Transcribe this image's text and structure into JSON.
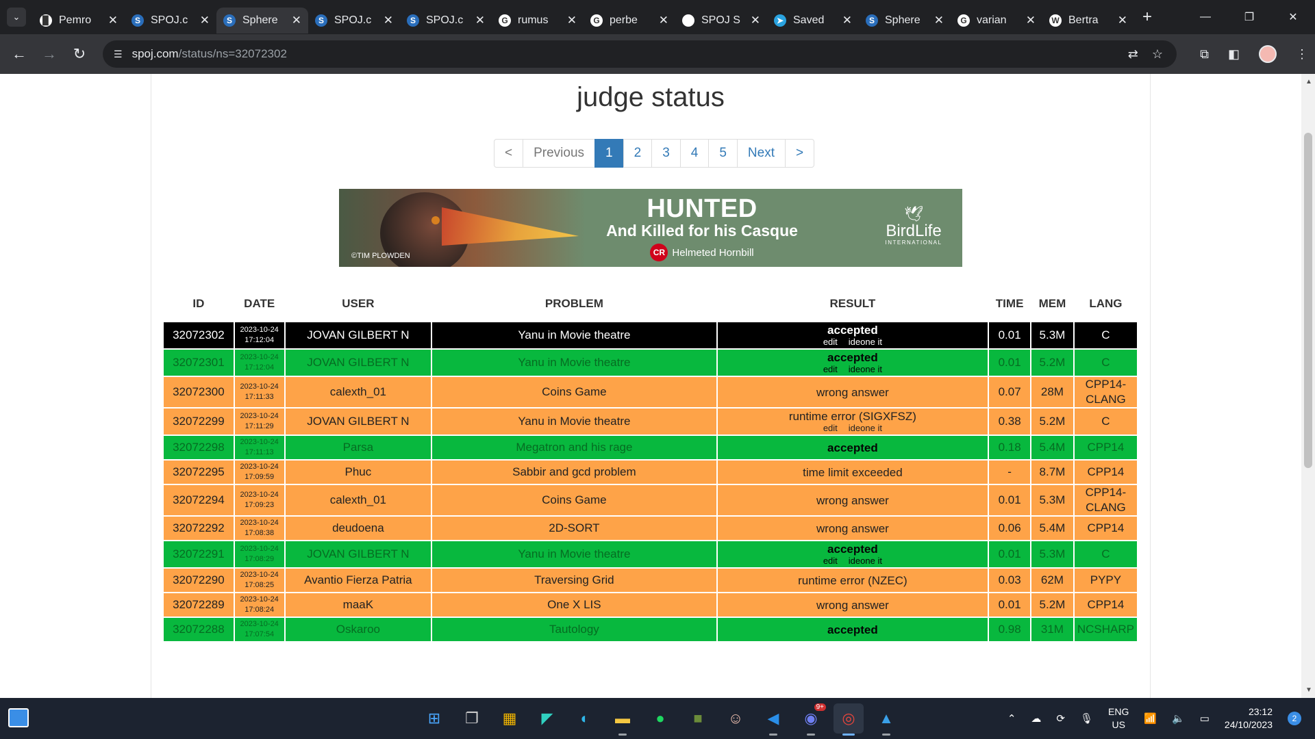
{
  "browser": {
    "tabs": [
      {
        "title": "Pemro",
        "favicon": "document-icon",
        "fav_color": "#ffffff",
        "fav_text": "▉",
        "active": false
      },
      {
        "title": "SPOJ.c",
        "favicon": "spoj-icon",
        "fav_color": "#2a6ebb",
        "fav_text": "S",
        "active": false
      },
      {
        "title": "Sphere",
        "favicon": "spoj-icon",
        "fav_color": "#2a6ebb",
        "fav_text": "S",
        "active": true
      },
      {
        "title": "SPOJ.c",
        "favicon": "spoj-icon",
        "fav_color": "#2a6ebb",
        "fav_text": "S",
        "active": false
      },
      {
        "title": "SPOJ.c",
        "favicon": "spoj-icon",
        "fav_color": "#2a6ebb",
        "fav_text": "S",
        "active": false
      },
      {
        "title": "rumus",
        "favicon": "google-icon",
        "fav_color": "#ffffff",
        "fav_text": "G",
        "active": false
      },
      {
        "title": "perbe",
        "favicon": "google-icon",
        "fav_color": "#ffffff",
        "fav_text": "G",
        "active": false
      },
      {
        "title": "SPOJ S",
        "favicon": "blank-page-icon",
        "fav_color": "#ffffff",
        "fav_text": "",
        "active": false
      },
      {
        "title": "Saved",
        "favicon": "telegram-icon",
        "fav_color": "#2aa3e0",
        "fav_text": "➤",
        "active": false
      },
      {
        "title": "Sphere",
        "favicon": "spoj-icon",
        "fav_color": "#2a6ebb",
        "fav_text": "S",
        "active": false
      },
      {
        "title": "varian",
        "favicon": "google-icon",
        "fav_color": "#ffffff",
        "fav_text": "G",
        "active": false
      },
      {
        "title": "Bertra",
        "favicon": "wikipedia-icon",
        "fav_color": "#ffffff",
        "fav_text": "W",
        "active": false
      }
    ],
    "url_domain": "spoj.com",
    "url_path": "/status/ns=32072302"
  },
  "page": {
    "title": "judge status",
    "pagination": {
      "first": "<",
      "prev": "Previous",
      "pages": [
        "1",
        "2",
        "3",
        "4",
        "5"
      ],
      "current": "1",
      "next": "Next",
      "last": ">"
    },
    "ad": {
      "credit": "©TIM PLOWDEN",
      "headline": "HUNTED",
      "subline": "And Killed for his Casque",
      "status_badge": "CR",
      "species": "Helmeted Hornbill",
      "logo_name": "BirdLife",
      "logo_sub": "INTERNATIONAL"
    }
  },
  "table": {
    "headers": [
      "ID",
      "DATE",
      "USER",
      "PROBLEM",
      "RESULT",
      "TIME",
      "MEM",
      "LANG"
    ],
    "rows": [
      {
        "style": "black",
        "id": "32072302",
        "date": "2023-10-24",
        "time_of_day": "17:12:04",
        "user": "JOVAN GILBERT N",
        "problem": "Yanu in Movie theatre",
        "result": "accepted",
        "result_bold": true,
        "links": true,
        "time": "0.01",
        "mem": "5.3M",
        "lang": "C"
      },
      {
        "style": "green",
        "id": "32072301",
        "date": "2023-10-24",
        "time_of_day": "17:12:04",
        "user": "JOVAN GILBERT N",
        "problem": "Yanu in Movie theatre",
        "result": "accepted",
        "result_bold": true,
        "links": true,
        "time": "0.01",
        "mem": "5.2M",
        "lang": "C"
      },
      {
        "style": "orange",
        "id": "32072300",
        "date": "2023-10-24",
        "time_of_day": "17:11:33",
        "user": "calexth_01",
        "problem": "Coins Game",
        "result": "wrong answer",
        "result_bold": false,
        "links": false,
        "time": "0.07",
        "mem": "28M",
        "lang": "CPP14-CLANG"
      },
      {
        "style": "orange",
        "id": "32072299",
        "date": "2023-10-24",
        "time_of_day": "17:11:29",
        "user": "JOVAN GILBERT N",
        "problem": "Yanu in Movie theatre",
        "result": "runtime error (SIGXFSZ)",
        "result_bold": false,
        "links": true,
        "time": "0.38",
        "mem": "5.2M",
        "lang": "C"
      },
      {
        "style": "green",
        "id": "32072298",
        "date": "2023-10-24",
        "time_of_day": "17:11:13",
        "user": "Parsa",
        "problem": "Megatron and his rage",
        "result": "accepted",
        "result_bold": true,
        "links": false,
        "time": "0.18",
        "mem": "5.4M",
        "lang": "CPP14"
      },
      {
        "style": "orange",
        "id": "32072295",
        "date": "2023-10-24",
        "time_of_day": "17:09:59",
        "user": "Phuc",
        "problem": "Sabbir and gcd problem",
        "result": "time limit exceeded",
        "result_bold": false,
        "links": false,
        "time": "-",
        "mem": "8.7M",
        "lang": "CPP14"
      },
      {
        "style": "orange",
        "id": "32072294",
        "date": "2023-10-24",
        "time_of_day": "17:09:23",
        "user": "calexth_01",
        "problem": "Coins Game",
        "result": "wrong answer",
        "result_bold": false,
        "links": false,
        "time": "0.01",
        "mem": "5.3M",
        "lang": "CPP14-CLANG"
      },
      {
        "style": "orange",
        "id": "32072292",
        "date": "2023-10-24",
        "time_of_day": "17:08:38",
        "user": "deudoena",
        "problem": "2D-SORT",
        "result": "wrong answer",
        "result_bold": false,
        "links": false,
        "time": "0.06",
        "mem": "5.4M",
        "lang": "CPP14"
      },
      {
        "style": "green",
        "id": "32072291",
        "date": "2023-10-24",
        "time_of_day": "17:08:29",
        "user": "JOVAN GILBERT N",
        "problem": "Yanu in Movie theatre",
        "result": "accepted",
        "result_bold": true,
        "links": true,
        "time": "0.01",
        "mem": "5.3M",
        "lang": "C"
      },
      {
        "style": "orange",
        "id": "32072290",
        "date": "2023-10-24",
        "time_of_day": "17:08:25",
        "user": "Avantio Fierza Patria",
        "problem": "Traversing Grid",
        "result": "runtime error (NZEC)",
        "result_bold": false,
        "links": false,
        "time": "0.03",
        "mem": "62M",
        "lang": "PYPY"
      },
      {
        "style": "orange",
        "id": "32072289",
        "date": "2023-10-24",
        "time_of_day": "17:08:24",
        "user": "maaK",
        "problem": "One X LIS",
        "result": "wrong answer",
        "result_bold": false,
        "links": false,
        "time": "0.01",
        "mem": "5.2M",
        "lang": "CPP14"
      },
      {
        "style": "green",
        "id": "32072288",
        "date": "2023-10-24",
        "time_of_day": "17:07:54",
        "user": "Oskaroo",
        "problem": "Tautology",
        "result": "accepted",
        "result_bold": true,
        "links": false,
        "time": "0.98",
        "mem": "31M",
        "lang": "NCSHARP"
      }
    ],
    "link_edit": "edit",
    "link_ideone": "ideone it",
    "colors": {
      "black": "#000000",
      "green": "#08b83e",
      "orange": "#fea348"
    }
  },
  "taskbar": {
    "apps": [
      {
        "name": "start-icon",
        "glyph": "⊞",
        "color": "#4aa8ff",
        "active": false,
        "running": false
      },
      {
        "name": "task-view-icon",
        "glyph": "❐",
        "color": "#d0d0d0",
        "active": false,
        "running": false
      },
      {
        "name": "store-icon",
        "glyph": "▦",
        "color": "#f0b400",
        "active": false,
        "running": false
      },
      {
        "name": "capcut-icon",
        "glyph": "◤",
        "color": "#30d0c0",
        "active": false,
        "running": false
      },
      {
        "name": "edge-icon",
        "glyph": "◐",
        "color": "#2fb6e8",
        "active": false,
        "running": false
      },
      {
        "name": "file-explorer-icon",
        "glyph": "▬",
        "color": "#f5c842",
        "active": false,
        "running": true
      },
      {
        "name": "spotify-icon",
        "glyph": "●",
        "color": "#1ed760",
        "active": false,
        "running": false
      },
      {
        "name": "minecraft-icon",
        "glyph": "■",
        "color": "#6b8c3a",
        "active": false,
        "running": false
      },
      {
        "name": "anime-app-icon",
        "glyph": "☺",
        "color": "#f0c0b0",
        "active": false,
        "running": false
      },
      {
        "name": "vscode-icon",
        "glyph": "◀",
        "color": "#2a8ee8",
        "active": false,
        "running": true
      },
      {
        "name": "discord-icon",
        "glyph": "◉",
        "color": "#6f7ff2",
        "active": false,
        "running": true,
        "badge": "9+"
      },
      {
        "name": "chrome-icon",
        "glyph": "◎",
        "color": "#e8453c",
        "active": true,
        "running": true
      },
      {
        "name": "photos-icon",
        "glyph": "▲",
        "color": "#3aa0e8",
        "active": false,
        "running": true
      }
    ],
    "lang_line1": "ENG",
    "lang_line2": "US",
    "time": "23:12",
    "date": "24/10/2023",
    "notifications": "2"
  }
}
